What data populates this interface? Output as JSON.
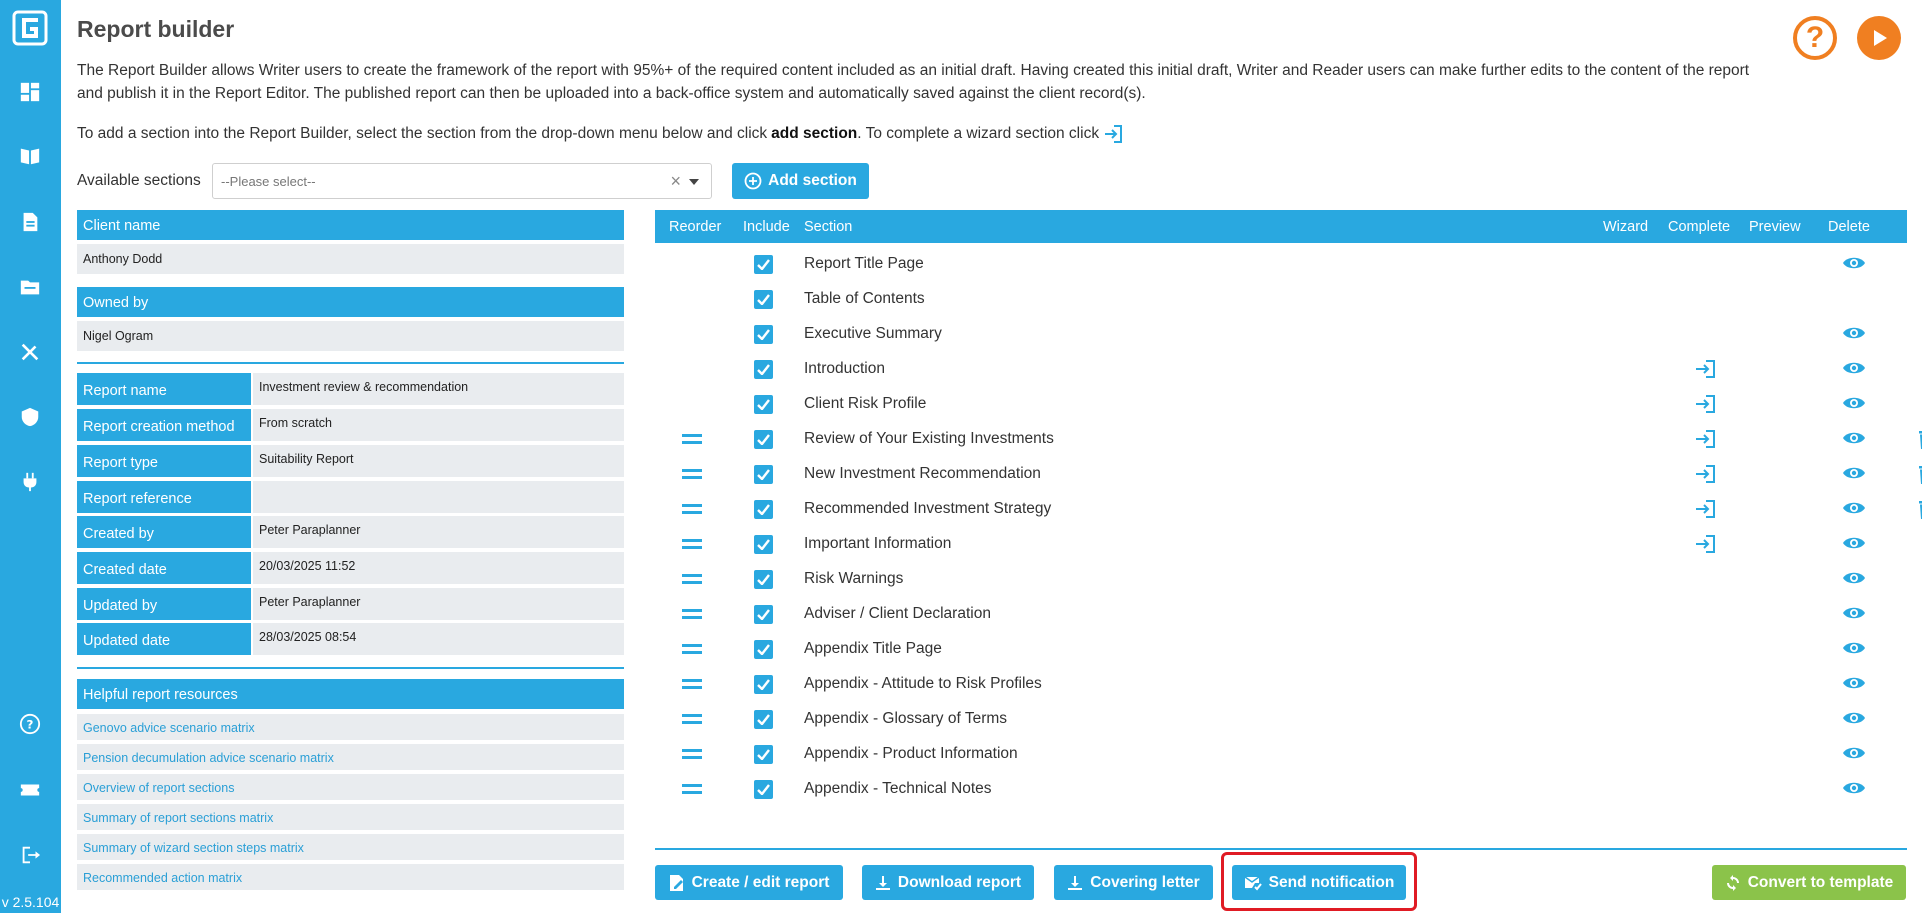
{
  "app": {
    "title": "Report builder",
    "version": "v 2.5.104"
  },
  "colors": {
    "accent": "#29a8e0",
    "orange": "#f07f21",
    "green": "#8bc34a",
    "highlight": "#e01b24"
  },
  "intro": {
    "paragraph1": "The Report Builder allows Writer users to create the framework of the report with 95%+ of the required content included as an initial draft. Having created this initial draft, Writer and Reader users can make further edits to the content of the report and publish it in the Report Editor. The published report can then be uploaded into a back-office system and automatically saved against the client record(s).",
    "paragraph2_before": "To add a section into the Report Builder, select the section from the drop-down menu below and click",
    "paragraph2_bold": "add section",
    "paragraph2_after": ". To complete a wizard section click"
  },
  "section_picker": {
    "label": "Available sections",
    "placeholder": "--Please select--",
    "add_label": "Add section"
  },
  "client": {
    "name_label": "Client name",
    "name": "Anthony Dodd",
    "owned_label": "Owned by",
    "owned": "Nigel Ogram"
  },
  "report_details": [
    {
      "key": "Report name",
      "value": "Investment review & recommendation"
    },
    {
      "key": "Report creation method",
      "value": "From scratch"
    },
    {
      "key": "Report type",
      "value": "Suitability Report"
    },
    {
      "key": "Report reference",
      "value": ""
    },
    {
      "key": "Created by",
      "value": "Peter Paraplanner"
    },
    {
      "key": "Created date",
      "value": "20/03/2025 11:52"
    },
    {
      "key": "Updated by",
      "value": "Peter Paraplanner"
    },
    {
      "key": "Updated date",
      "value": "28/03/2025 08:54"
    }
  ],
  "resources": {
    "title": "Helpful report resources",
    "items": [
      "Genovo advice scenario matrix",
      "Pension decumulation advice scenario matrix",
      "Overview of report sections",
      "Summary of report sections matrix",
      "Summary of wizard section steps matrix",
      "Recommended action matrix"
    ]
  },
  "table": {
    "headers": {
      "reorder": "Reorder",
      "include": "Include",
      "section": "Section",
      "wizard": "Wizard",
      "complete": "Complete",
      "preview": "Preview",
      "delete": "Delete"
    },
    "rows": [
      {
        "name": "Report Title Page",
        "reorder": false,
        "wizard": false,
        "preview": true,
        "delete": false
      },
      {
        "name": "Table of Contents",
        "reorder": false,
        "wizard": false,
        "preview": false,
        "delete": false
      },
      {
        "name": "Executive Summary",
        "reorder": false,
        "wizard": false,
        "preview": true,
        "delete": false
      },
      {
        "name": "Introduction",
        "reorder": false,
        "wizard": true,
        "preview": true,
        "delete": false
      },
      {
        "name": "Client Risk Profile",
        "reorder": false,
        "wizard": true,
        "preview": true,
        "delete": false
      },
      {
        "name": "Review of Your Existing Investments",
        "reorder": true,
        "wizard": true,
        "preview": true,
        "delete": true
      },
      {
        "name": "New Investment Recommendation",
        "reorder": true,
        "wizard": true,
        "preview": true,
        "delete": true
      },
      {
        "name": "Recommended Investment Strategy",
        "reorder": true,
        "wizard": true,
        "preview": true,
        "delete": true
      },
      {
        "name": "Important Information",
        "reorder": true,
        "wizard": true,
        "preview": true,
        "delete": false
      },
      {
        "name": "Risk Warnings",
        "reorder": true,
        "wizard": false,
        "preview": true,
        "delete": false
      },
      {
        "name": "Adviser / Client Declaration",
        "reorder": true,
        "wizard": false,
        "preview": true,
        "delete": false
      },
      {
        "name": "Appendix Title Page",
        "reorder": true,
        "wizard": false,
        "preview": true,
        "delete": false
      },
      {
        "name": "Appendix - Attitude to Risk Profiles",
        "reorder": true,
        "wizard": false,
        "preview": true,
        "delete": false
      },
      {
        "name": "Appendix - Glossary of Terms",
        "reorder": true,
        "wizard": false,
        "preview": true,
        "delete": false
      },
      {
        "name": "Appendix - Product Information",
        "reorder": true,
        "wizard": false,
        "preview": true,
        "delete": false
      },
      {
        "name": "Appendix - Technical Notes",
        "reorder": true,
        "wizard": false,
        "preview": true,
        "delete": false
      }
    ]
  },
  "actions": {
    "create": "Create / edit report",
    "download": "Download report",
    "covering": "Covering letter",
    "notify": "Send notification",
    "template": "Convert to template"
  }
}
